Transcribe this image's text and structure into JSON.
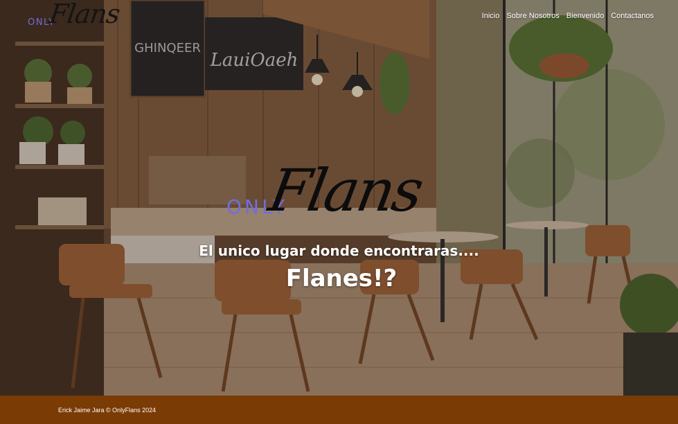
{
  "logo": {
    "only": "ONLY",
    "flans": "Flans"
  },
  "nav": {
    "items": [
      "Inicio",
      "Sobre Nosotros",
      "Bienvenido",
      "Contactanos"
    ]
  },
  "hero": {
    "brand_only": "ONLY",
    "brand_flans": "Flans",
    "tagline": "El unico lugar donde encontraras....",
    "headline": "Flanes!?",
    "background": "cafe-interior-photo",
    "chalkboard_1": "GHINQEER",
    "chalkboard_2": "LauiOaeh"
  },
  "footer": {
    "copyright": "Erick Jaime Jara © OnlyFlans 2024",
    "color": "#7b3b04"
  },
  "colors": {
    "logo_only": "#6f6fd8",
    "footer": "#7b3b04",
    "text": "#ffffff"
  }
}
